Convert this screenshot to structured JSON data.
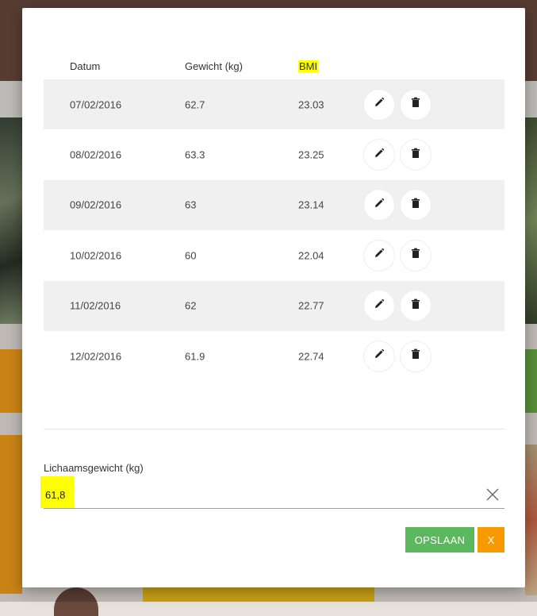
{
  "table": {
    "headers": {
      "date": "Datum",
      "weight": "Gewicht (kg)",
      "bmi": "BMI"
    },
    "rows": [
      {
        "date": "07/02/2016",
        "weight": "62.7",
        "bmi": "23.03"
      },
      {
        "date": "08/02/2016",
        "weight": "63.3",
        "bmi": "23.25"
      },
      {
        "date": "09/02/2016",
        "weight": "63",
        "bmi": "23.14"
      },
      {
        "date": "10/02/2016",
        "weight": "60",
        "bmi": "22.04"
      },
      {
        "date": "11/02/2016",
        "weight": "62",
        "bmi": "22.77"
      },
      {
        "date": "12/02/2016",
        "weight": "61.9",
        "bmi": "22.74"
      }
    ],
    "row_icons": {
      "edit": "pencil-icon",
      "delete": "trash-icon"
    }
  },
  "form": {
    "label": "Lichaamsgewicht (kg)",
    "value": "61,8",
    "clear_icon": "close-icon"
  },
  "buttons": {
    "save": "OPSLAAN",
    "close": "X"
  },
  "colors": {
    "save": "#5cb85c",
    "close": "#f79a00",
    "highlight": "#ffff00"
  }
}
